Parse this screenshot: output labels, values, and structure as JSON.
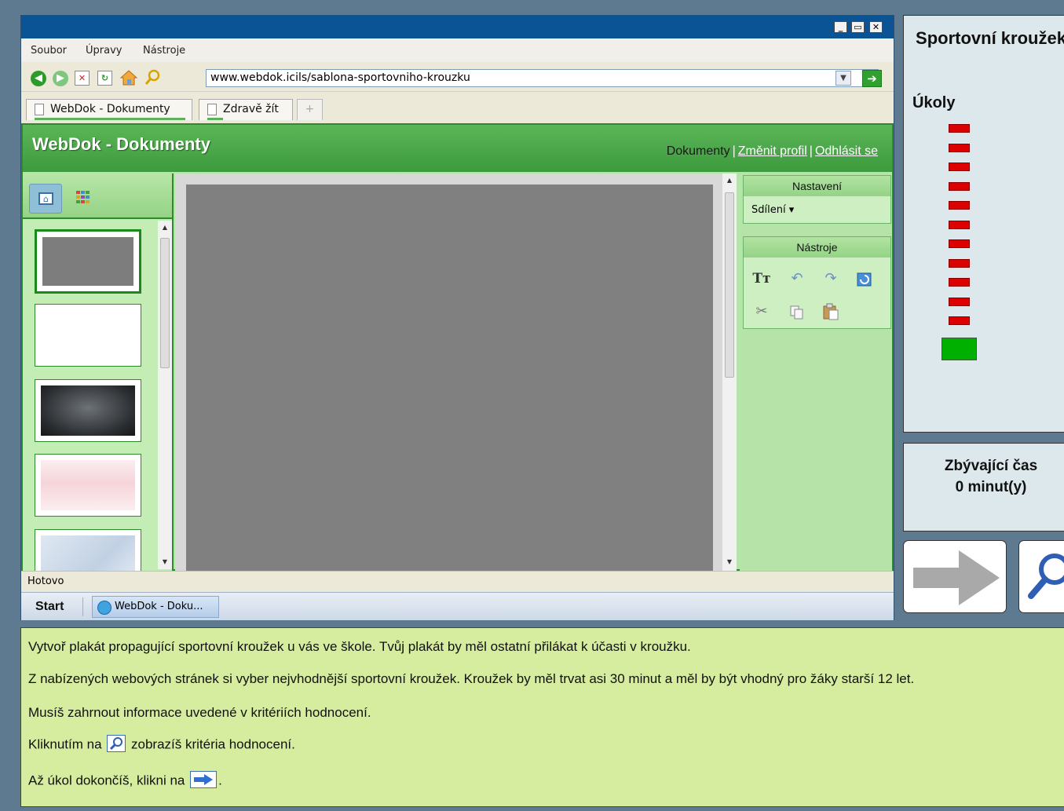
{
  "browser": {
    "menu": [
      "Soubor",
      "Úpravy",
      "Nástroje"
    ],
    "url": "www.webdok.icils/sablona-sportovniho-krouzku",
    "tabs": [
      {
        "label": "WebDok - Dokumenty",
        "active": true
      },
      {
        "label": "Zdravě žít",
        "active": false
      }
    ],
    "new_tab": "+",
    "window_buttons": {
      "minimize": "_",
      "restore": "▭",
      "close": "✕"
    }
  },
  "app": {
    "title": "WebDok - Dokumenty",
    "links": {
      "documents": "Dokumenty",
      "change_profile": "Změnit profil",
      "logout": "Odhlásit se"
    },
    "settings_panel": {
      "title": "Nastavení",
      "sharing": "Sdílení ▾"
    },
    "tools_panel": {
      "title": "Nástroje",
      "text_tool": "Tт"
    }
  },
  "status": {
    "text": "Hotovo"
  },
  "taskbar": {
    "start": "Start",
    "item": "WebDok - Doku..."
  },
  "task": {
    "title": "Sportovní kroužek",
    "tasks_label": "Úkoly",
    "task_count": 12,
    "current_task_index": 12,
    "colors": {
      "done": "#dd0000",
      "current": "#00b000"
    }
  },
  "timer": {
    "label": "Zbývající čas",
    "value": "0 minut(y)"
  },
  "instructions": {
    "line1": "Vytvoř plakát propagující sportovní kroužek u vás ve škole. Tvůj plakát by měl ostatní přilákat k účasti v kroužku.",
    "line2": "Z nabízených webových stránek si vyber nejvhodnější sportovní kroužek. Kroužek by měl trvat asi 30 minut a měl by být vhodný pro žáky starší 12 let.",
    "line3": "Musíš zahrnout informace uvedené v kritériích hodnocení.",
    "line4a": "Kliknutím na",
    "line4b": "zobrazíš kritéria hodnocení.",
    "line5a": "Až úkol dokončíš, klikni na",
    "line5b": "."
  }
}
